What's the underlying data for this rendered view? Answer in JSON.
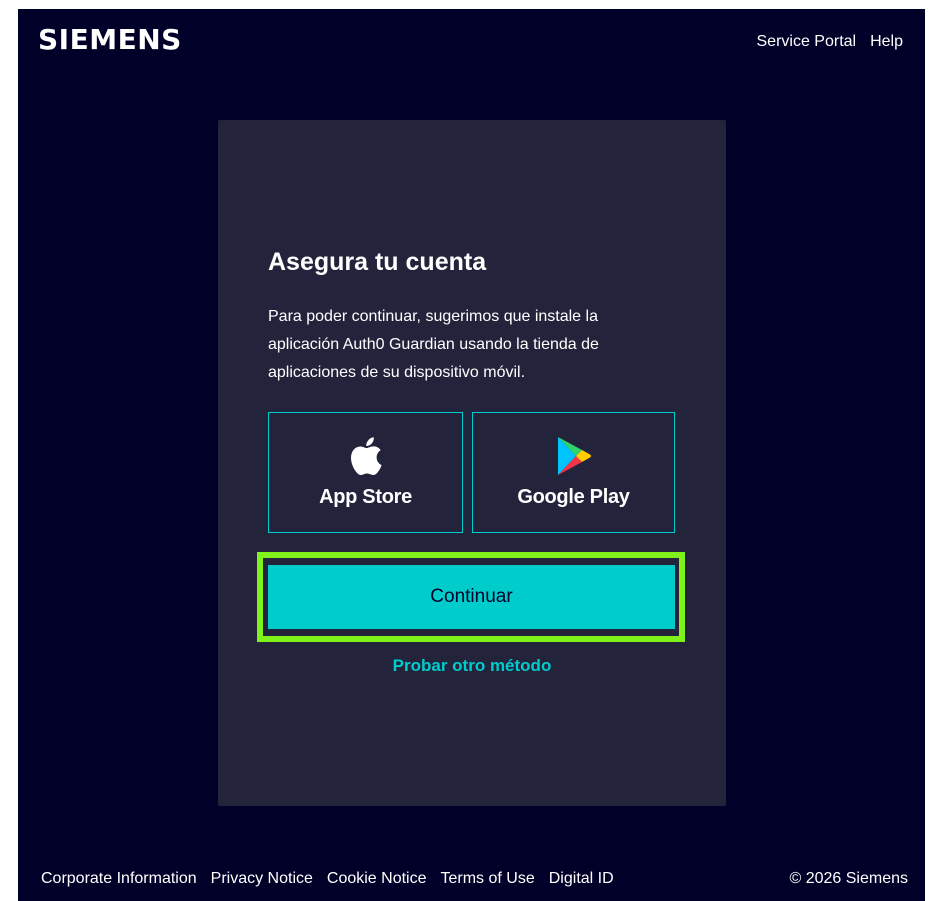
{
  "header": {
    "brand": "SIEMENS",
    "links": [
      "Service Portal",
      "Help"
    ]
  },
  "card": {
    "title": "Asegura tu cuenta",
    "description": "Para poder continuar, sugerimos que instale la aplicación Auth0 Guardian usando la tienda de aplicaciones de su dispositivo móvil.",
    "stores": {
      "apple": {
        "label": "App Store",
        "icon": "apple-icon"
      },
      "google": {
        "label": "Google Play",
        "icon": "google-play-icon"
      }
    },
    "continue_label": "Continuar",
    "alt_method_label": "Probar otro método"
  },
  "footer": {
    "links": [
      "Corporate Information",
      "Privacy Notice",
      "Cookie Notice",
      "Terms of Use",
      "Digital ID"
    ],
    "copyright": "© 2026 Siemens"
  },
  "colors": {
    "background": "#000028",
    "card": "#23233c",
    "accent": "#00cccc",
    "highlight": "#7ff21a",
    "text": "#ffffff"
  }
}
